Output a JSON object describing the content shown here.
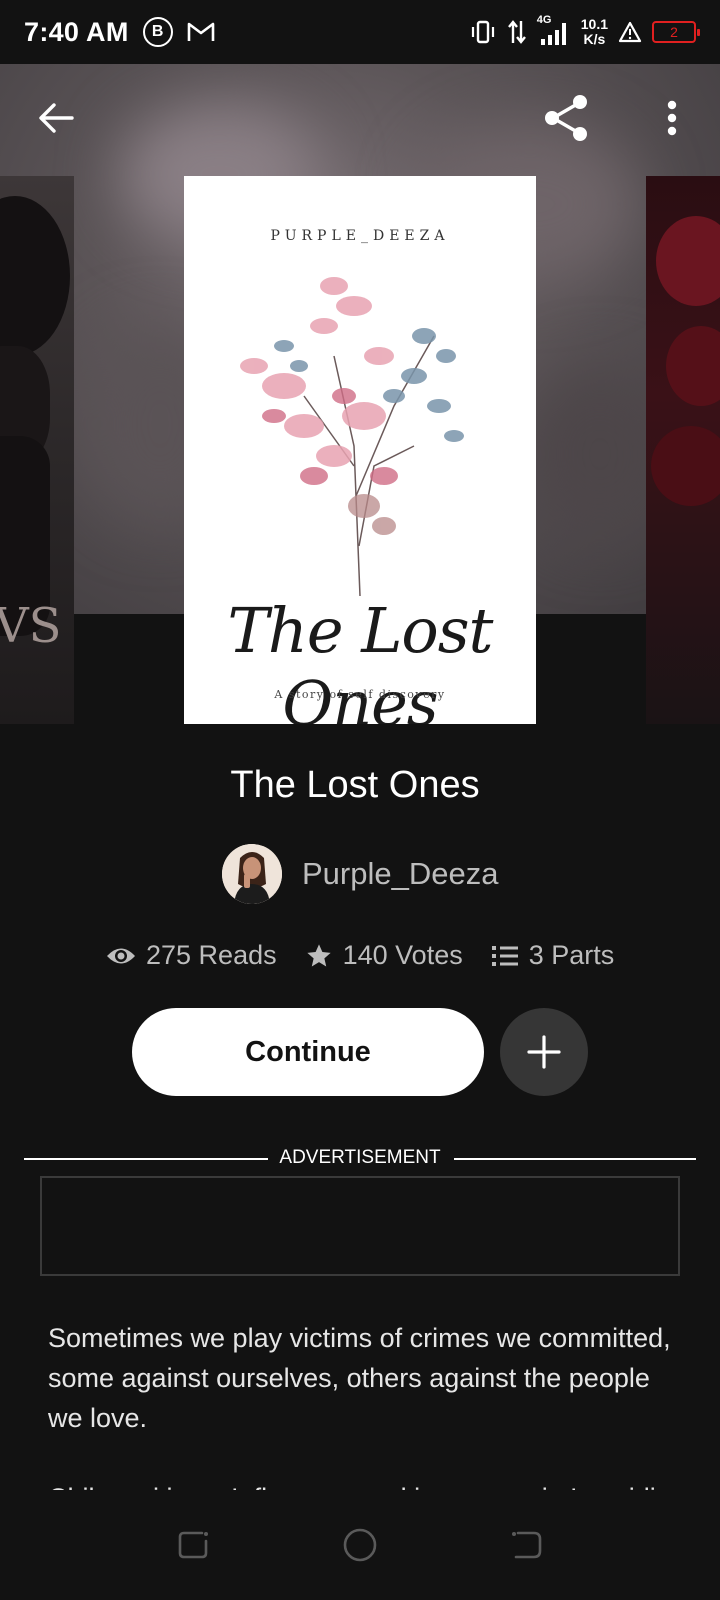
{
  "status_bar": {
    "time": "7:40 AM",
    "b_badge": "B",
    "network_type": "4G",
    "speed_value": "10.1",
    "speed_unit": "K/s",
    "battery_level": "2"
  },
  "story": {
    "title": "The Lost Ones",
    "author": "Purple_Deeza",
    "reads": "275 Reads",
    "votes": "140 Votes",
    "parts": "3 Parts"
  },
  "cover": {
    "author_text": "PURPLE_DEEZA",
    "title_text": "The Lost Ones",
    "subtitle_text": "A story of self discovery"
  },
  "left_cover_text": "VS",
  "actions": {
    "continue_label": "Continue"
  },
  "ad": {
    "label": "ADVERTISEMENT"
  },
  "description": {
    "paragraph1": "Sometimes we play victims of crimes we committed, some against ourselves, others against the people we love.",
    "paragraph2": "Chikamsi is an Influencer, making waves in Lasgidi"
  },
  "icons": {
    "back": "arrow-left-icon",
    "share": "share-icon",
    "more": "more-vertical-icon",
    "reads": "eye-icon",
    "votes": "star-icon",
    "parts": "list-icon",
    "add": "plus-icon"
  }
}
